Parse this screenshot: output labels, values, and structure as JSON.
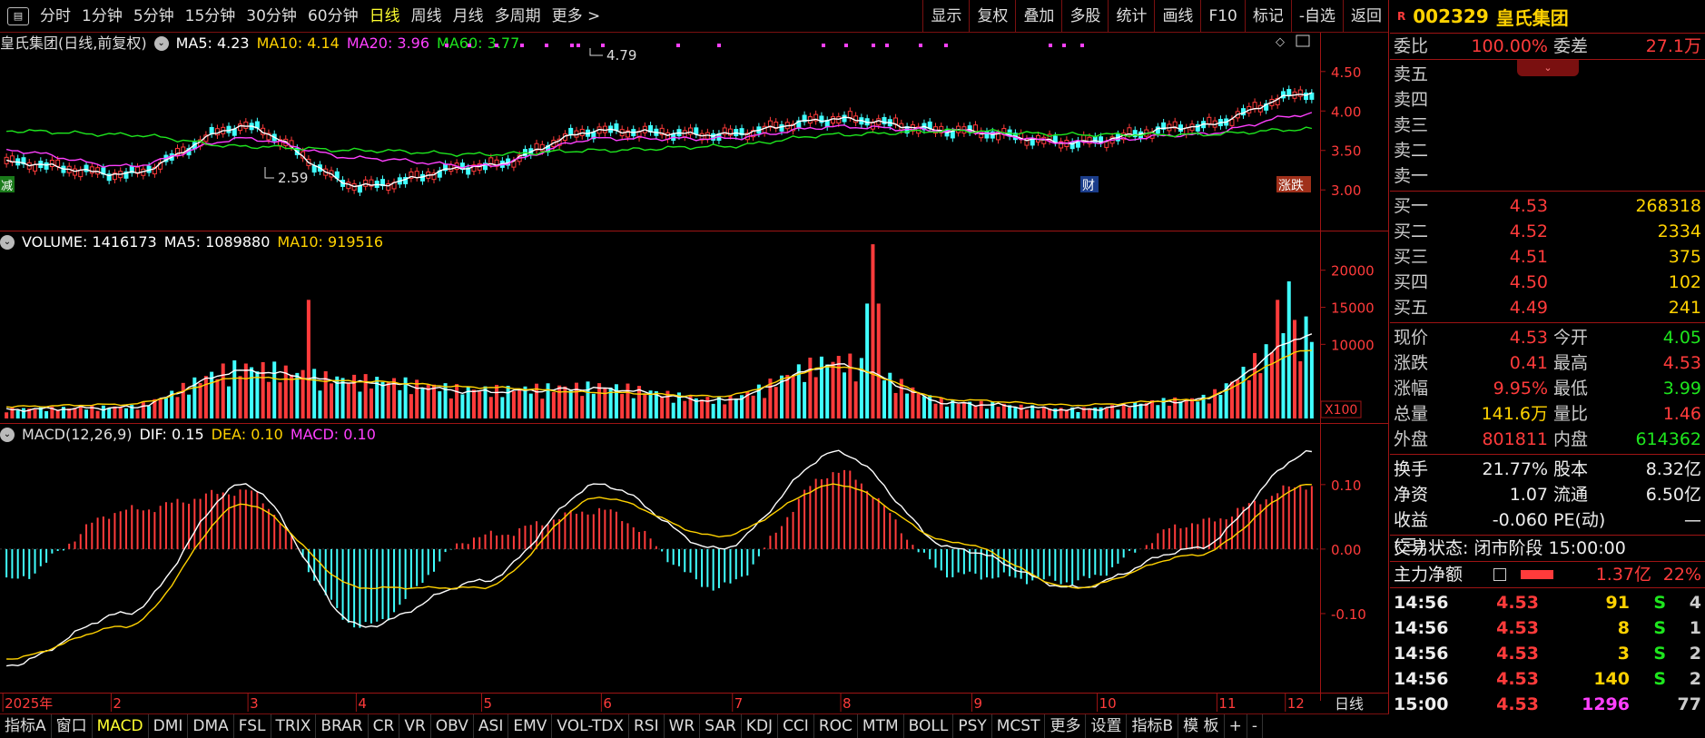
{
  "toolbar": {
    "periods": [
      "分时",
      "1分钟",
      "5分钟",
      "15分钟",
      "30分钟",
      "60分钟",
      "日线",
      "周线",
      "月线",
      "多周期",
      "更多 >"
    ],
    "active_period": "日线",
    "tools": [
      "显示",
      "复权",
      "叠加",
      "多股",
      "统计",
      "画线",
      "F10",
      "标记",
      "-自选",
      "返回"
    ]
  },
  "main_panel": {
    "title": "皇氏集团(日线,前复权)",
    "ma5": "MA5: 4.23",
    "ma10": "MA10: 4.14",
    "ma20": "MA20: 3.96",
    "ma60": "MA60: 3.77",
    "y_ticks": [
      "4.50",
      "4.00",
      "3.50",
      "3.00"
    ],
    "high_label": "4.79",
    "low_label": "2.59",
    "badge_left": "减",
    "badge_cai": "财",
    "badge_right": "涨跌"
  },
  "volume_panel": {
    "label": "VOLUME: 1416173",
    "ma5": "MA5: 1089880",
    "ma10": "MA10: 919516",
    "y_ticks": [
      "20000",
      "15000",
      "10000"
    ],
    "unit": "X100"
  },
  "macd_panel": {
    "label": "MACD(12,26,9)",
    "dif": "DIF: 0.15",
    "dea": "DEA: 0.10",
    "macd": "MACD: 0.10",
    "y_ticks": [
      "0.10",
      "0.00",
      "-0.10"
    ]
  },
  "x_axis": {
    "labels": [
      "2025年",
      "2",
      "3",
      "4",
      "5",
      "6",
      "7",
      "8",
      "9",
      "10",
      "11",
      "12"
    ],
    "period_label": "日线"
  },
  "indicators": [
    "指标A",
    "窗口",
    "MACD",
    "DMI",
    "DMA",
    "FSL",
    "TRIX",
    "BRAR",
    "CR",
    "VR",
    "OBV",
    "ASI",
    "EMV",
    "VOL-TDX",
    "RSI",
    "WR",
    "SAR",
    "KDJ",
    "CCI",
    "ROC",
    "MTM",
    "BOLL",
    "PSY",
    "MCST",
    "更多",
    "设置",
    "指标B",
    "模 板",
    "+",
    "-"
  ],
  "active_indicator": "MACD",
  "quote": {
    "badge": "R",
    "code": "002329",
    "name": "皇氏集团",
    "weibi_label": "委比",
    "weibi": "100.00%",
    "weicha_label": "委差",
    "weicha": "27.1万",
    "sells": [
      {
        "label": "卖五"
      },
      {
        "label": "卖四"
      },
      {
        "label": "卖三"
      },
      {
        "label": "卖二"
      },
      {
        "label": "卖一"
      }
    ],
    "buys": [
      {
        "label": "买一",
        "price": "4.53",
        "vol": "268318"
      },
      {
        "label": "买二",
        "price": "4.52",
        "vol": "2334"
      },
      {
        "label": "买三",
        "price": "4.51",
        "vol": "375"
      },
      {
        "label": "买四",
        "price": "4.50",
        "vol": "102"
      },
      {
        "label": "买五",
        "price": "4.49",
        "vol": "241"
      }
    ],
    "stats": [
      {
        "l1": "现价",
        "v1": "4.53",
        "c1": "c-red",
        "l2": "今开",
        "v2": "4.05",
        "c2": "c-green"
      },
      {
        "l1": "涨跌",
        "v1": "0.41",
        "c1": "c-red",
        "l2": "最高",
        "v2": "4.53",
        "c2": "c-red"
      },
      {
        "l1": "涨幅",
        "v1": "9.95%",
        "c1": "c-red",
        "l2": "最低",
        "v2": "3.99",
        "c2": "c-green"
      },
      {
        "l1": "总量",
        "v1": "141.6万",
        "c1": "c-yellow",
        "l2": "量比",
        "v2": "1.46",
        "c2": "c-red"
      },
      {
        "l1": "外盘",
        "v1": "801811",
        "c1": "c-red",
        "l2": "内盘",
        "v2": "614362",
        "c2": "c-green"
      }
    ],
    "stats2": [
      {
        "l1": "换手",
        "v1": "21.77%",
        "l2": "股本",
        "v2": "8.32亿"
      },
      {
        "l1": "净资",
        "v1": "1.07",
        "l2": "流通",
        "v2": "6.50亿"
      },
      {
        "l1": "收益(三)",
        "v1": "-0.060",
        "l2": "PE(动)",
        "v2": "—"
      }
    ],
    "status": "交易状态: 闭市阶段 15:00:00",
    "net_label": "主力净额",
    "net_value": "1.37亿",
    "net_pct": "22%",
    "ticks": [
      {
        "time": "14:56",
        "price": "4.53",
        "vol": "91",
        "side": "S",
        "n": "4"
      },
      {
        "time": "14:56",
        "price": "4.53",
        "vol": "8",
        "side": "S",
        "n": "1"
      },
      {
        "time": "14:56",
        "price": "4.53",
        "vol": "3",
        "side": "S",
        "n": "2"
      },
      {
        "time": "14:56",
        "price": "4.53",
        "vol": "140",
        "side": "S",
        "n": "2"
      },
      {
        "time": "15:00",
        "price": "4.53",
        "vol": "1296",
        "side": "",
        "n": "77"
      }
    ]
  },
  "chart_data": [
    {
      "type": "line",
      "title": "皇氏集团(日线,前复权)",
      "x": [
        "2025年",
        "2",
        "3",
        "4",
        "5",
        "6",
        "7",
        "8",
        "9",
        "10",
        "11",
        "12"
      ],
      "series": [
        {
          "name": "MA5",
          "values": [
            3.35,
            3.2,
            3.8,
            3.05,
            3.3,
            3.75,
            3.7,
            3.9,
            3.75,
            3.6,
            3.8,
            4.23
          ]
        },
        {
          "name": "MA20",
          "values": [
            3.5,
            3.3,
            3.65,
            3.4,
            3.3,
            3.65,
            3.65,
            3.8,
            3.75,
            3.6,
            3.7,
            3.96
          ]
        },
        {
          "name": "MA60",
          "values": [
            3.75,
            3.7,
            3.55,
            3.5,
            3.45,
            3.5,
            3.55,
            3.7,
            3.75,
            3.7,
            3.7,
            3.77
          ]
        }
      ],
      "ylim": [
        2.6,
        4.9
      ],
      "annotations": [
        "4.79",
        "2.59"
      ]
    },
    {
      "type": "bar",
      "title": "VOLUME",
      "x": [
        "2025年",
        "2",
        "3",
        "4",
        "5",
        "6",
        "7",
        "8",
        "9",
        "10",
        "11",
        "12"
      ],
      "series": [
        {
          "name": "VOLUME",
          "values": [
            1500,
            1800,
            8000,
            6000,
            4500,
            5000,
            3000,
            9000,
            2500,
            1500,
            3000,
            14000
          ]
        },
        {
          "name": "MA10",
          "values": [
            1600,
            1900,
            5500,
            5000,
            4200,
            3500,
            3000,
            7000,
            2500,
            1800,
            2500,
            9195
          ]
        }
      ],
      "ylim": [
        0,
        24000
      ]
    },
    {
      "type": "bar",
      "title": "MACD(12,26,9)",
      "x": [
        "2025年",
        "2",
        "3",
        "4",
        "5",
        "6",
        "7",
        "8",
        "9",
        "10",
        "11",
        "12"
      ],
      "series": [
        {
          "name": "MACD",
          "values": [
            -0.05,
            0.06,
            0.09,
            -0.12,
            0.02,
            0.06,
            -0.06,
            0.12,
            -0.04,
            -0.05,
            0.04,
            0.1
          ]
        },
        {
          "name": "DIF",
          "values": [
            -0.18,
            -0.1,
            0.1,
            -0.12,
            -0.05,
            0.1,
            0.0,
            0.15,
            0.0,
            -0.06,
            0.0,
            0.15
          ]
        },
        {
          "name": "DEA",
          "values": [
            -0.17,
            -0.12,
            0.07,
            -0.06,
            -0.06,
            0.08,
            0.02,
            0.1,
            0.01,
            -0.06,
            -0.01,
            0.1
          ]
        }
      ],
      "ylim": [
        -0.2,
        0.18
      ]
    }
  ]
}
